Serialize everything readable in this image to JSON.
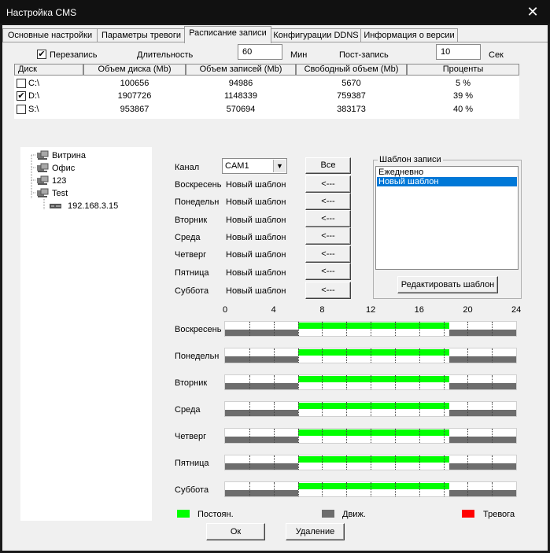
{
  "window": {
    "title": "Настройка CMS",
    "close_glyph": "✕"
  },
  "tabs": [
    {
      "label": "Основные настройки"
    },
    {
      "label": "Параметры тревоги"
    },
    {
      "label": "Расписание записи",
      "active": true
    },
    {
      "label": "Конфигурации DDNS"
    },
    {
      "label": "Информация о версии"
    }
  ],
  "settings": {
    "overwrite_label": "Перезапись",
    "overwrite_checked": "✔",
    "duration_label": "Длительность",
    "duration_value": "60",
    "duration_unit": "Мин",
    "post_label": "Пост-запись",
    "post_value": "10",
    "post_unit": "Сек"
  },
  "disks": {
    "columns": [
      "Диск",
      "Объем диска (Mb)",
      "Объем записей (Mb)",
      "Свободный объем (Mb)",
      "Проценты"
    ],
    "rows": [
      {
        "checked": "",
        "disk": "C:\\",
        "size": "100656",
        "records": "94986",
        "free": "5670",
        "percent": "5 %"
      },
      {
        "checked": "✔",
        "disk": "D:\\",
        "size": "1907726",
        "records": "1148339",
        "free": "759387",
        "percent": "39 %"
      },
      {
        "checked": "",
        "disk": "S:\\",
        "size": "953867",
        "records": "570694",
        "free": "383173",
        "percent": "40 %"
      }
    ]
  },
  "tree": {
    "items": [
      {
        "label": "Витрина"
      },
      {
        "label": "Офис"
      },
      {
        "label": "123"
      },
      {
        "label": "Test"
      },
      {
        "label": "192.168.3.15"
      }
    ]
  },
  "channel": {
    "label": "Канал",
    "value": "CAM1",
    "all_button": "Все"
  },
  "days": [
    {
      "label": "Воскресень",
      "template": "Новый шаблон",
      "assign": "<---",
      "timeline_label": "Воскресень"
    },
    {
      "label": "Понедельн",
      "template": "Новый шаблон",
      "assign": "<---",
      "timeline_label": "Понедельн"
    },
    {
      "label": "Вторник",
      "template": "Новый шаблон",
      "assign": "<---",
      "timeline_label": "Вторник"
    },
    {
      "label": "Среда",
      "template": "Новый шаблон",
      "assign": "<---",
      "timeline_label": "Среда"
    },
    {
      "label": "Четверг",
      "template": "Новый шаблон",
      "assign": "<---",
      "timeline_label": "Четверг"
    },
    {
      "label": "Пятница",
      "template": "Новый шаблон",
      "assign": "<---",
      "timeline_label": "Пятница"
    },
    {
      "label": "Суббота",
      "template": "Новый шаблон",
      "assign": "<---",
      "timeline_label": "Суббота"
    }
  ],
  "template_group": {
    "title": "Шаблон записи",
    "items": [
      {
        "label": "Ежедневно"
      },
      {
        "label": "Новый шаблон",
        "selected": true
      }
    ],
    "edit_button": "Редактировать шаблон"
  },
  "schedule": {
    "hour_labels": [
      "0",
      "4",
      "8",
      "12",
      "16",
      "20",
      "24"
    ],
    "constant_start_hour": 6,
    "constant_end_hour": 18.5,
    "motion_ranges": [
      [
        0,
        6
      ],
      [
        18.5,
        24
      ]
    ]
  },
  "legend": {
    "constant": {
      "label": "Постоян.",
      "color": "#00ff00"
    },
    "motion": {
      "label": "Движ.",
      "color": "#6d6d6d"
    },
    "alarm": {
      "label": "Тревога",
      "color": "#ff0000"
    }
  },
  "buttons": {
    "ok": "Ок",
    "delete": "Удаление"
  }
}
